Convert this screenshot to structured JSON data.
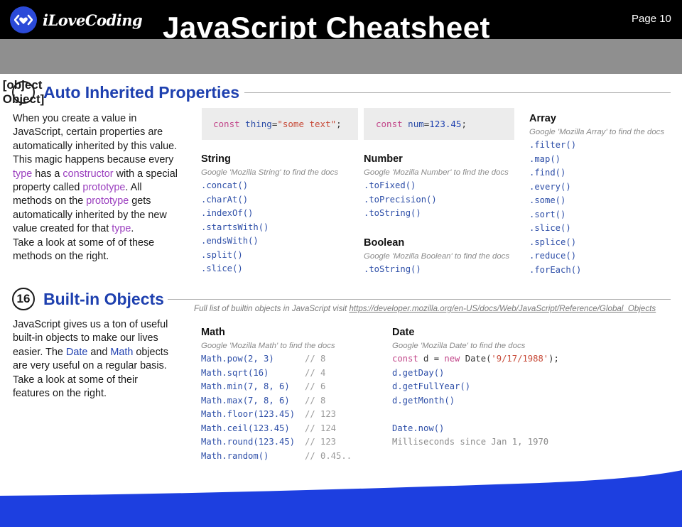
{
  "header": {
    "logo_text": "iLoveCoding",
    "title": "JavaScript Cheatsheet",
    "page": "Page 10"
  },
  "section15": {
    "number": {
      "title": "Number",
      "note": "Google 'Mozilla Number' to find the docs",
      "methods": [
        ".toFixed()",
        ".toPrecision()",
        ".toString()"
      ]
    },
    "title": "Auto Inherited Properties",
    "paragraph": [
      "When you create a value in",
      "JavaScript, certain properties are",
      "automatically inherited by this value.",
      "This magic happens because every",
      [
        "type",
        " has a ",
        "constructor",
        " with a special"
      ],
      [
        "property called ",
        "prototype",
        ". All"
      ],
      [
        "methods on the ",
        "prototype",
        " gets"
      ],
      "automatically inherited by the new",
      [
        "value created for that ",
        "type",
        "."
      ],
      "Take a look at some of of these",
      "methods on the right."
    ],
    "code_string": {
      "kw": "const",
      "var": "thing",
      "eq": " = ",
      "val": "\"some text\"",
      "end": ";"
    },
    "code_number": {
      "kw": "const",
      "var": "num",
      "eq": " = ",
      "val": "123.45",
      "end": ";"
    },
    "string": {
      "title": "String",
      "note": "Google 'Mozilla String' to find the docs",
      "methods": [
        ".concat()",
        ".charAt()",
        ".indexOf()",
        ".startsWith()",
        ".endsWith()",
        ".split()",
        ".slice()"
      ]
    },
    "boolean": {
      "title": "Boolean",
      "note": "Google 'Mozilla Boolean' to find the docs",
      "methods": [
        ".toString()"
      ]
    },
    "array": {
      "title": "Array",
      "note": "Google 'Mozilla Array' to find the docs",
      "methods": [
        ".filter()",
        ".map()",
        ".find()",
        ".every()",
        ".some()",
        ".sort()",
        ".slice()",
        ".splice()",
        ".reduce()",
        ".forEach()"
      ]
    }
  },
  "section16": {
    "number": "16",
    "title": "Built-in Objects",
    "paragraph": [
      "JavaScript gives us a ton of useful",
      "built-in objects to make our lives",
      [
        "easier. The ",
        "Date",
        " and ",
        "Math",
        " objects"
      ],
      "are very useful on a regular basis.",
      "Take a look at some of their",
      "features on the right."
    ],
    "full_list_text": "Full list of builtin objects in JavaScript visit ",
    "full_list_link": "https://developer.mozilla.org/en-US/docs/Web/JavaScript/Reference/Global_Objects",
    "math": {
      "title": "Math",
      "note": "Google 'Mozilla Math' to find the docs",
      "rows": [
        {
          "code": "Math.pow(2, 3)",
          "comment": "// 8"
        },
        {
          "code": "Math.sqrt(16)",
          "comment": "// 4"
        },
        {
          "code": "Math.min(7, 8, 6)",
          "comment": "// 6"
        },
        {
          "code": "Math.max(7, 8, 6)",
          "comment": "// 8"
        },
        {
          "code": "Math.floor(123.45)",
          "comment": "// 123"
        },
        {
          "code": "Math.ceil(123.45)",
          "comment": "// 124"
        },
        {
          "code": "Math.round(123.45)",
          "comment": "// 123"
        },
        {
          "code": "Math.random()",
          "comment": "// 0.45.."
        }
      ]
    },
    "date": {
      "title": "Date",
      "note": "Google 'Mozilla Date' to find the docs",
      "decl": {
        "kw": "const",
        "var": " d = ",
        "kw2": "new",
        "cls": " Date(",
        "str": "'9/17/1988'",
        "end": ");"
      },
      "methods": [
        "d.getDay()",
        "d.getFullYear()",
        "d.getMonth()"
      ],
      "now": "Date.now()",
      "now_note": "Milliseconds since Jan 1, 1970"
    }
  },
  "colors": {
    "accent_blue": "#1e40af",
    "highlight_purple": "#9b3fbf",
    "footer_blue": "#1d3fe0"
  }
}
